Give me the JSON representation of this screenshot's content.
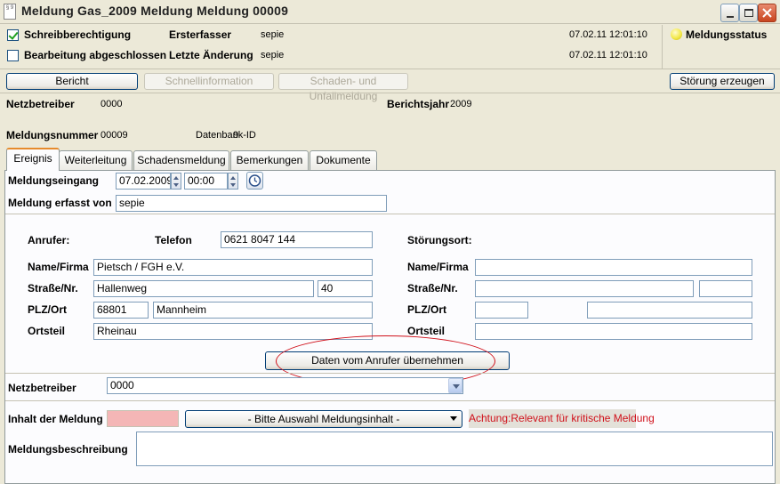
{
  "window": {
    "title": "Meldung Gas_2009  Meldung  Meldung 00009",
    "app_icon_text": "§ 9"
  },
  "header": {
    "schreibberechtigung": {
      "label": "Schreibberechtigung",
      "checked": true
    },
    "bearbeitung_abgeschlossen": {
      "label": "Bearbeitung abgeschlossen",
      "checked": false
    },
    "ersterfasser_label": "Ersterfasser",
    "ersterfasser_value": "sepie",
    "ersterfasser_time": "07.02.11 12:01:10",
    "letzte_aenderung_label": "Letzte Änderung",
    "letzte_aenderung_value": "sepie",
    "letzte_aenderung_time": "07.02.11 12:01:10",
    "meldungsstatus_label": "Meldungsstatus",
    "status_color": "#f3e94a"
  },
  "toolbar": {
    "bericht": "Bericht",
    "schnellinformation": "Schnellinformation",
    "schaden_unfall": "Schaden- und Unfallmeldung",
    "stoerung_erzeugen": "Störung erzeugen"
  },
  "info": {
    "netzbetreiber_label": "Netzbetreiber",
    "netzbetreiber_value": "0000",
    "berichtsjahr_label": "Berichtsjahr",
    "berichtsjahr_value": "2009",
    "meldungsnummer_label": "Meldungsnummer",
    "meldungsnummer_value": "00009",
    "datenbank_label": "Datenbank-ID",
    "datenbank_value": "9"
  },
  "tabs": [
    {
      "label": "Ereignis",
      "active": true
    },
    {
      "label": "Weiterleitung",
      "active": false
    },
    {
      "label": "Schadensmeldung",
      "active": false
    },
    {
      "label": "Bemerkungen",
      "active": false
    },
    {
      "label": "Dokumente",
      "active": false
    }
  ],
  "ereignis": {
    "meldungseingang_label": "Meldungseingang",
    "meldungseingang_date": "07.02.2009",
    "meldungseingang_time": "00:00",
    "erfasst_von_label": "Meldung erfasst von",
    "erfasst_von_value": "sepie",
    "anrufer_label": "Anrufer:",
    "telefon_label": "Telefon",
    "telefon_value": "0621 8047 144",
    "stoerungsort_label": "Störungsort:",
    "name_firma_label": "Name/Firma",
    "name_firma_value": "Pietsch / FGH e.V.",
    "strasse_label": "Straße/Nr.",
    "strasse_value": "Hallenweg",
    "hausnr_value": "40",
    "plz_ort_label": "PLZ/Ort",
    "plz_value": "68801",
    "ort_value": "Mannheim",
    "ortsteil_label": "Ortsteil",
    "ortsteil_value": "Rheinau",
    "s_name_firma_label": "Name/Firma",
    "s_strasse_label": "Straße/Nr.",
    "s_plz_ort_label": "PLZ/Ort",
    "s_ortsteil_label": "Ortsteil",
    "uebernehmen_button": "Daten vom Anrufer übernehmen",
    "netzbetreiber_label": "Netzbetreiber",
    "netzbetreiber_value": "0000",
    "inhalt_label": "Inhalt der Meldung",
    "inhalt_select": "- Bitte Auswahl Meldungsinhalt -",
    "inhalt_warning": "Achtung:Relevant für kritische Meldung",
    "beschreibung_label": "Meldungsbeschreibung",
    "highlight_color": "#d0101a"
  }
}
